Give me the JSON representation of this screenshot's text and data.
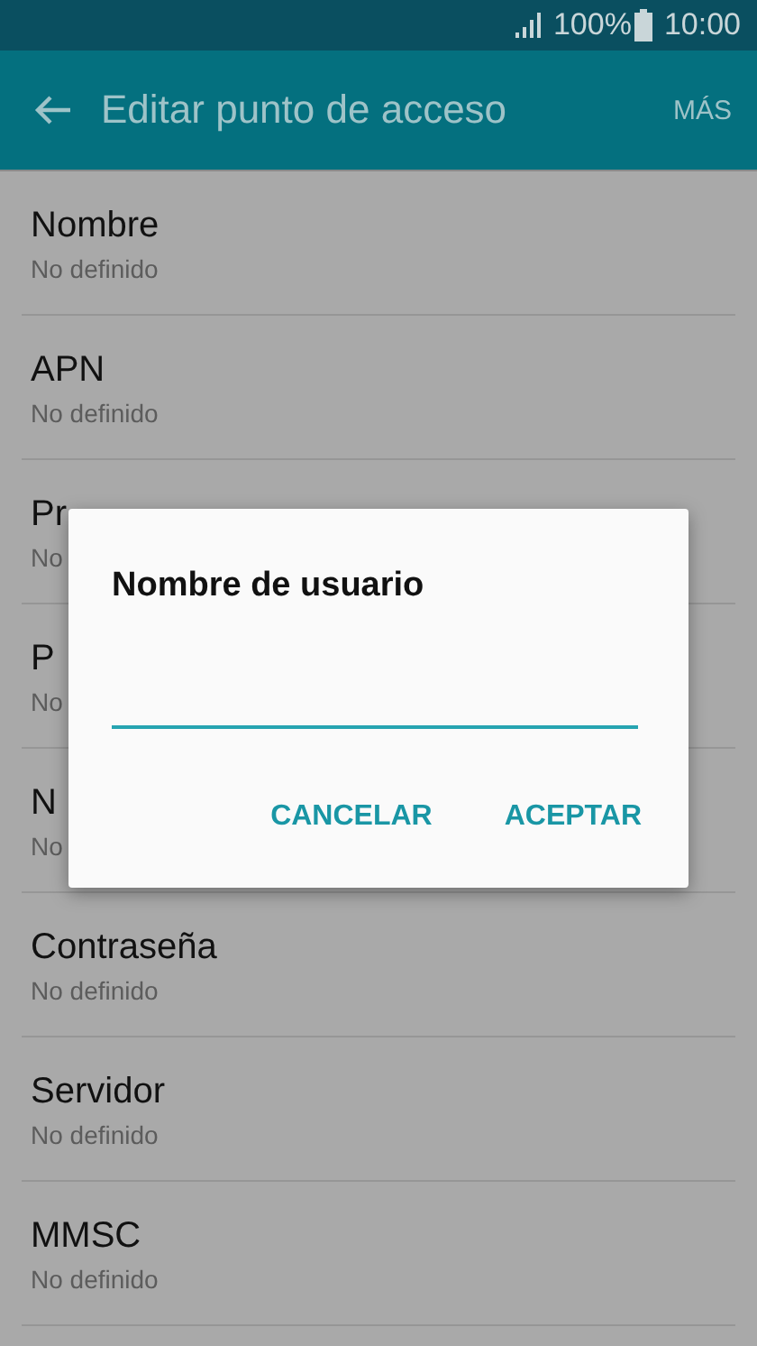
{
  "status_bar": {
    "battery": "100%",
    "time": "10:00"
  },
  "header": {
    "title": "Editar punto de acceso",
    "action": "MÁS"
  },
  "rows": [
    {
      "title": "Nombre",
      "subtitle": "No definido"
    },
    {
      "title": "APN",
      "subtitle": "No definido"
    },
    {
      "title": "Pr",
      "subtitle": "No"
    },
    {
      "title": "P",
      "subtitle": "No"
    },
    {
      "title": "N",
      "subtitle": "No"
    },
    {
      "title": "Contraseña",
      "subtitle": "No definido"
    },
    {
      "title": "Servidor",
      "subtitle": "No definido"
    },
    {
      "title": "MMSC",
      "subtitle": "No definido"
    }
  ],
  "dialog": {
    "title": "Nombre de usuario",
    "buttons": [
      "CANCELAR",
      "ACEPTAR"
    ]
  }
}
